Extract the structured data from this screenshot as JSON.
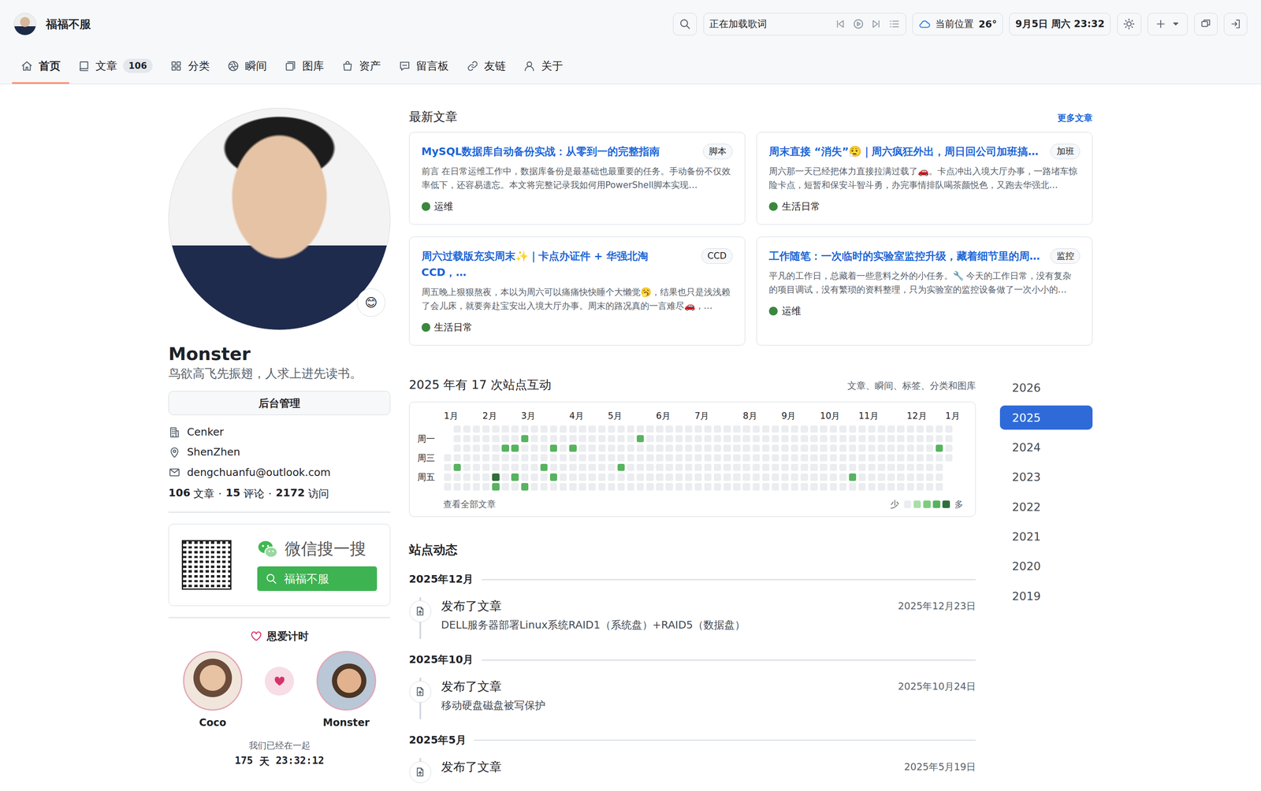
{
  "header": {
    "site_name": "福福不服",
    "lyrics": "正在加载歌词",
    "weather_label": "当前位置",
    "temperature": "26°",
    "datetime": "9月5日 周六 23:32"
  },
  "nav": [
    {
      "label": "首页",
      "selected": true
    },
    {
      "label": "文章",
      "count": "106",
      "selected": false
    },
    {
      "label": "分类",
      "selected": false
    },
    {
      "label": "瞬间",
      "selected": false
    },
    {
      "label": "图库",
      "selected": false
    },
    {
      "label": "资产",
      "selected": false
    },
    {
      "label": "留言板",
      "selected": false
    },
    {
      "label": "友链",
      "selected": false
    },
    {
      "label": "关于",
      "selected": false
    }
  ],
  "profile": {
    "status_emoji": "😊",
    "name": "Monster",
    "bio": "鸟欲高飞先振翅，人求上进先读书。",
    "admin_button": "后台管理",
    "details": [
      {
        "kind": "company",
        "text": "Cenker"
      },
      {
        "kind": "location",
        "text": "ShenZhen"
      },
      {
        "kind": "email",
        "text": "dengchuanfu@outlook.com"
      }
    ],
    "stats": [
      {
        "value": "106",
        "label": "文章"
      },
      {
        "value": "15",
        "label": "评论"
      },
      {
        "value": "2172",
        "label": "访问"
      }
    ],
    "separator": "·"
  },
  "wechat": {
    "title": "微信搜一搜",
    "search_button": "福福不服"
  },
  "love": {
    "title": "恩爱计时",
    "people": [
      {
        "name": "Coco"
      },
      {
        "name": "Monster"
      }
    ],
    "caption": "我们已经在一起",
    "days": "175",
    "days_unit": "天",
    "time": "23:32:12"
  },
  "latest": {
    "title": "最新文章",
    "more": "更多文章",
    "articles": [
      {
        "title": "MySQL数据库自动备份实战：从零到一的完整指南",
        "tag": "脚本",
        "excerpt": "前言 在日常运维工作中，数据库备份是最基础也最重要的任务。手动备份不仅效率低下，还容易遗忘。本文将完整记录我如何用PowerShell脚本实现…",
        "category": "运维"
      },
      {
        "title": "周末直接 “消失”😮‍💨｜周六疯狂外出，周日回公司加班搞…",
        "tag": "加班",
        "excerpt": "周六那一天已经把体力直接拉满过载了🚗。卡点冲出入境大厅办事，一路堵车惊险卡点，短暂和保安斗智斗勇，办完事情排队喝茶颜悦色，又跑去华强北…",
        "category": "生活日常"
      },
      {
        "title": "周六过载版充实周末✨｜卡点办证件 + 华强北淘 CCD，…",
        "tag": "CCD",
        "excerpt": "周五晚上狠狠熬夜，本以为周六可以痛痛快快睡个大懒觉🥱，结果也只是浅浅赖了会儿床，就要奔赴宝安出入境大厅办事。周末的路况真的一言难尽🚗，…",
        "category": "生活日常"
      },
      {
        "title": "工作随笔：一次临时的实验室监控升级，藏着细节里的周…",
        "tag": "监控",
        "excerpt": "平凡的工作日，总藏着一些意料之外的小任务。🔧 今天的工作日常，没有复杂的项目调试，没有繁琐的资料整理，只为实验室的监控设备做了一次小小的…",
        "category": "运维"
      }
    ]
  },
  "activity_chart": {
    "title": "2025 年有 17 次站点互动",
    "subtitle": "文章、瞬间、标签、分类和图库",
    "months": [
      {
        "label": "1月",
        "col": 0
      },
      {
        "label": "2月",
        "col": 4
      },
      {
        "label": "3月",
        "col": 8
      },
      {
        "label": "4月",
        "col": 13
      },
      {
        "label": "5月",
        "col": 17
      },
      {
        "label": "6月",
        "col": 22
      },
      {
        "label": "7月",
        "col": 26
      },
      {
        "label": "8月",
        "col": 31
      },
      {
        "label": "9月",
        "col": 35
      },
      {
        "label": "10月",
        "col": 39
      },
      {
        "label": "11月",
        "col": 43
      },
      {
        "label": "12月",
        "col": 48
      },
      {
        "label": "1月",
        "col": 52
      }
    ],
    "weekdays": [
      {
        "label": "周一",
        "row": 1
      },
      {
        "label": "周三",
        "row": 3
      },
      {
        "label": "周五",
        "row": 5
      }
    ],
    "weeks": [
      [
        null,
        null,
        null,
        0,
        0,
        0,
        0
      ],
      [
        0,
        0,
        0,
        0,
        3,
        0,
        0
      ],
      [
        0,
        0,
        0,
        0,
        0,
        0,
        0
      ],
      [
        0,
        0,
        0,
        0,
        0,
        0,
        0
      ],
      [
        0,
        0,
        0,
        0,
        0,
        0,
        0
      ],
      [
        0,
        0,
        0,
        0,
        0,
        4,
        3
      ],
      [
        0,
        0,
        3,
        0,
        0,
        0,
        0
      ],
      [
        0,
        0,
        3,
        0,
        0,
        3,
        0
      ],
      [
        0,
        3,
        0,
        0,
        0,
        0,
        3
      ],
      [
        0,
        0,
        0,
        0,
        0,
        0,
        0
      ],
      [
        0,
        0,
        0,
        0,
        3,
        0,
        0
      ],
      [
        0,
        0,
        3,
        0,
        0,
        3,
        0
      ],
      [
        0,
        0,
        0,
        0,
        0,
        0,
        0
      ],
      [
        0,
        0,
        3,
        0,
        0,
        0,
        0
      ],
      [
        0,
        0,
        0,
        0,
        0,
        0,
        0
      ],
      [
        0,
        0,
        0,
        0,
        0,
        0,
        0
      ],
      [
        0,
        0,
        0,
        0,
        0,
        0,
        0
      ],
      [
        0,
        0,
        0,
        0,
        0,
        0,
        0
      ],
      [
        0,
        0,
        0,
        0,
        3,
        0,
        0
      ],
      [
        0,
        0,
        0,
        0,
        0,
        0,
        0
      ],
      [
        0,
        3,
        0,
        0,
        0,
        0,
        0
      ],
      [
        0,
        0,
        0,
        0,
        0,
        0,
        0
      ],
      [
        0,
        0,
        0,
        0,
        0,
        0,
        0
      ],
      [
        0,
        0,
        0,
        0,
        0,
        0,
        0
      ],
      [
        0,
        0,
        0,
        0,
        0,
        0,
        0
      ],
      [
        0,
        0,
        0,
        0,
        0,
        0,
        0
      ],
      [
        0,
        0,
        0,
        0,
        0,
        0,
        0
      ],
      [
        0,
        0,
        0,
        0,
        0,
        0,
        0
      ],
      [
        0,
        0,
        0,
        0,
        0,
        0,
        0
      ],
      [
        0,
        0,
        0,
        0,
        0,
        0,
        0
      ],
      [
        0,
        0,
        0,
        0,
        0,
        0,
        0
      ],
      [
        0,
        0,
        0,
        0,
        0,
        0,
        0
      ],
      [
        0,
        0,
        0,
        0,
        0,
        0,
        0
      ],
      [
        0,
        0,
        0,
        0,
        0,
        0,
        0
      ],
      [
        0,
        0,
        0,
        0,
        0,
        0,
        0
      ],
      [
        0,
        0,
        0,
        0,
        0,
        0,
        0
      ],
      [
        0,
        0,
        0,
        0,
        0,
        0,
        0
      ],
      [
        0,
        0,
        0,
        0,
        0,
        0,
        0
      ],
      [
        0,
        0,
        0,
        0,
        0,
        0,
        0
      ],
      [
        0,
        0,
        0,
        0,
        0,
        0,
        0
      ],
      [
        0,
        0,
        0,
        0,
        0,
        0,
        0
      ],
      [
        0,
        0,
        0,
        0,
        0,
        0,
        0
      ],
      [
        0,
        0,
        0,
        0,
        0,
        3,
        0
      ],
      [
        0,
        0,
        0,
        0,
        0,
        0,
        0
      ],
      [
        0,
        0,
        0,
        0,
        0,
        0,
        0
      ],
      [
        0,
        0,
        0,
        0,
        0,
        0,
        0
      ],
      [
        0,
        0,
        0,
        0,
        0,
        0,
        0
      ],
      [
        0,
        0,
        0,
        0,
        0,
        0,
        0
      ],
      [
        0,
        0,
        0,
        0,
        0,
        0,
        0
      ],
      [
        0,
        0,
        0,
        0,
        0,
        0,
        0
      ],
      [
        0,
        0,
        0,
        0,
        0,
        0,
        0
      ],
      [
        0,
        0,
        3,
        0,
        0,
        0,
        0
      ],
      [
        0,
        0,
        0,
        0,
        null,
        null,
        null
      ]
    ],
    "view_all": "查看全部文章",
    "legend": {
      "less": "少",
      "more": "多",
      "levels": [
        0,
        1,
        2,
        3,
        4
      ]
    }
  },
  "years": [
    {
      "label": "2026",
      "selected": false
    },
    {
      "label": "2025",
      "selected": true
    },
    {
      "label": "2024",
      "selected": false
    },
    {
      "label": "2023",
      "selected": false
    },
    {
      "label": "2022",
      "selected": false
    },
    {
      "label": "2021",
      "selected": false
    },
    {
      "label": "2020",
      "selected": false
    },
    {
      "label": "2019",
      "selected": false
    }
  ],
  "timeline": {
    "title": "站点动态",
    "groups": [
      {
        "month": "2025年12月",
        "events": [
          {
            "action": "发布了文章",
            "date": "2025年12月23日",
            "title": "DELL服务器部署Linux系统RAID1（系统盘）+RAID5（数据盘）"
          }
        ]
      },
      {
        "month": "2025年10月",
        "events": [
          {
            "action": "发布了文章",
            "date": "2025年10月24日",
            "title": "移动硬盘磁盘被写保护"
          }
        ]
      },
      {
        "month": "2025年5月",
        "events": [
          {
            "action": "发布了文章",
            "date": "2025年5月19日"
          }
        ]
      }
    ]
  }
}
